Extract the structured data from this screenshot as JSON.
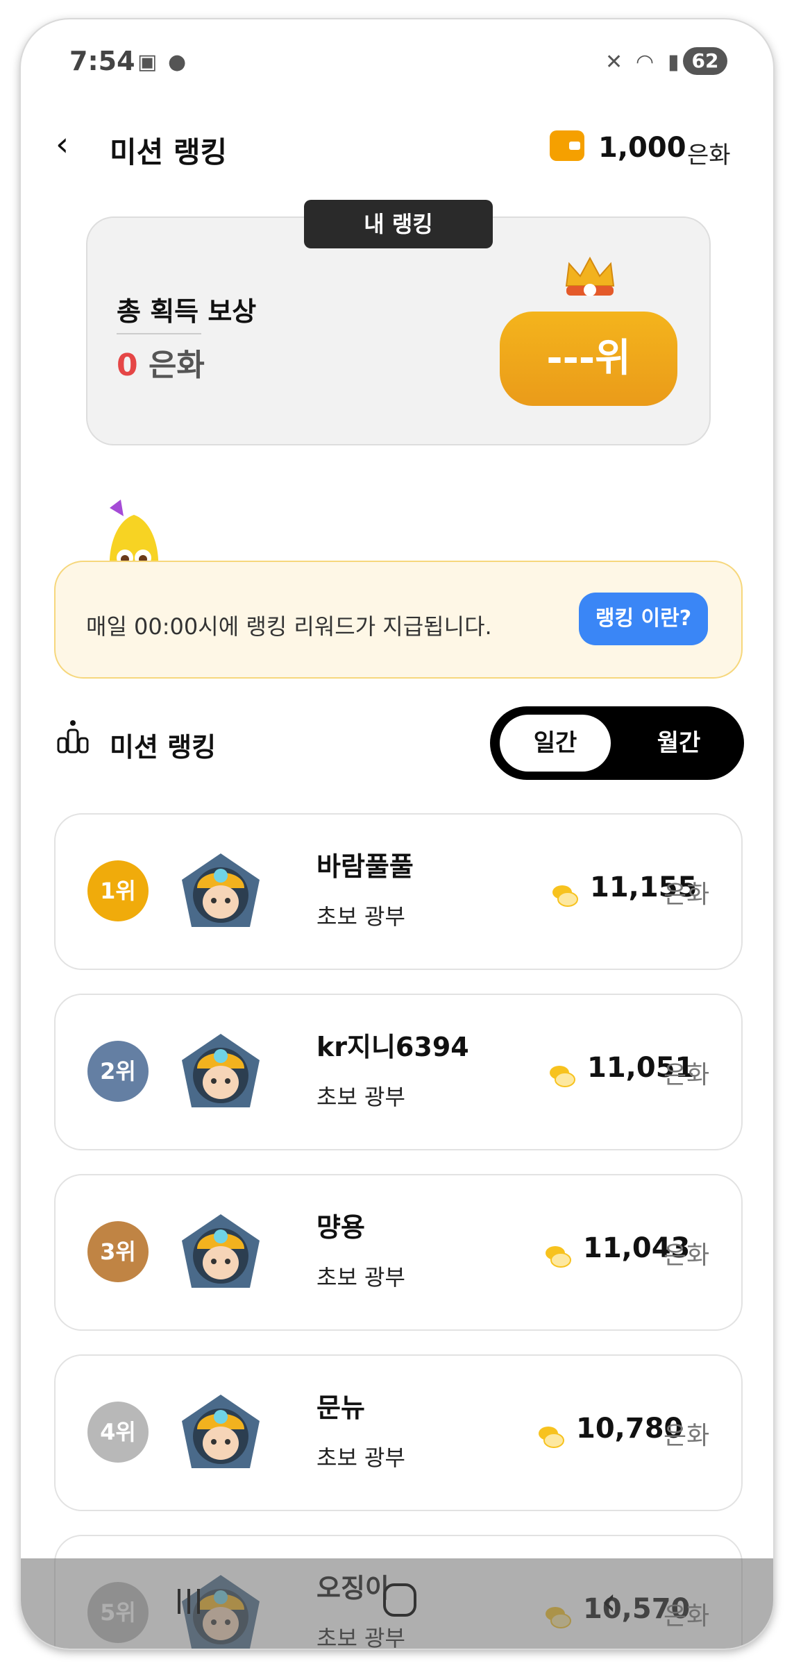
{
  "status_bar": {
    "time": "7:54",
    "battery": "62"
  },
  "header": {
    "title": "미션 랭킹",
    "balance": "1,000",
    "balance_unit": "은화"
  },
  "my_ranking": {
    "tag": "내 랭킹",
    "reward_label": "총 획득 보상",
    "reward_value": "0",
    "reward_unit": "은화",
    "rank": "---위"
  },
  "notice": {
    "text": "매일 00:00시에 랭킹 리워드가 지급됩니다.",
    "button": "랭킹 이란?"
  },
  "ranking_section": {
    "title": "미션 랭킹",
    "tabs": [
      "일간",
      "월간"
    ],
    "active_tab": "일간"
  },
  "rankings": [
    {
      "rank": "1위",
      "name": "바람풀풀",
      "level": "초보 광부",
      "score": "11,155",
      "unit": "은화",
      "badge_color": "#f0ab0b"
    },
    {
      "rank": "2위",
      "name": "kr지니6394",
      "level": "초보 광부",
      "score": "11,051",
      "unit": "은화",
      "badge_color": "#647fa3"
    },
    {
      "rank": "3위",
      "name": "먕용",
      "level": "초보 광부",
      "score": "11,043",
      "unit": "은화",
      "badge_color": "#c08444"
    },
    {
      "rank": "4위",
      "name": "문뉴",
      "level": "초보 광부",
      "score": "10,780",
      "unit": "은화",
      "badge_color": "#b8b8b8"
    },
    {
      "rank": "5위",
      "name": "오징이",
      "level": "초보 광부",
      "score": "10,570",
      "unit": "은화",
      "badge_color": "#b8b8b8"
    }
  ],
  "colors": {
    "accent_orange": "#f0a818",
    "notice_blue": "#3a86f6",
    "reward_red": "#e54646"
  }
}
